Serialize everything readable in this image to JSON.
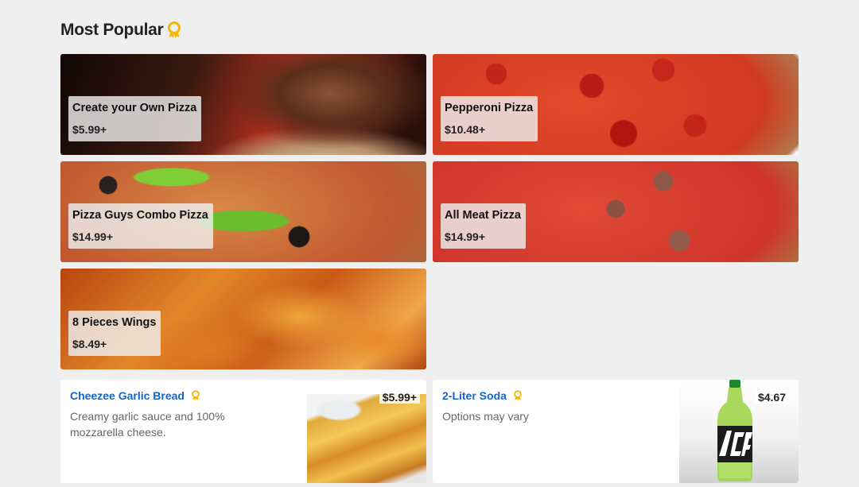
{
  "section": {
    "title": "Most Popular",
    "badge_icon": "ribbon-award-icon",
    "badge_color": "#f5b800"
  },
  "featured": [
    {
      "name": "Create your Own Pizza",
      "price": "$5.99+"
    },
    {
      "name": "Pepperoni Pizza",
      "price": "$10.48+"
    },
    {
      "name": "Pizza Guys Combo Pizza",
      "price": "$14.99+"
    },
    {
      "name": "All Meat Pizza",
      "price": "$14.99+"
    },
    {
      "name": "8 Pieces Wings",
      "price": "$8.49+"
    }
  ],
  "products": [
    {
      "name": "Cheezee Garlic Bread",
      "description": "Creamy garlic sauce and 100% mozzarella cheese.",
      "price": "$5.99+"
    },
    {
      "name": "2-Liter Soda",
      "description": "Options may vary",
      "price": "$4.67"
    }
  ],
  "colors": {
    "link": "#1565c8",
    "background": "#efeff0"
  }
}
